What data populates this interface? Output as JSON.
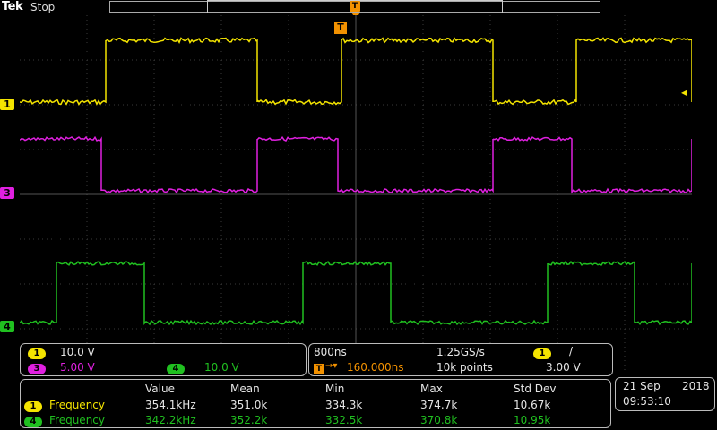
{
  "header": {
    "brand": "Tek",
    "run_state": "Stop"
  },
  "markers": {
    "trigger_glyph": "T",
    "trigger_level_glyph": "◂"
  },
  "channels": [
    {
      "id": "1",
      "color": "#f4e400"
    },
    {
      "id": "3",
      "color": "#e020e0"
    },
    {
      "id": "4",
      "color": "#20c020"
    }
  ],
  "scale_panel": {
    "ch1_id": "1",
    "ch1_scale": "10.0 V",
    "ch3_id": "3",
    "ch3_scale": "5.00 V",
    "ch4_id": "4",
    "ch4_scale": "10.0 V"
  },
  "timebase_panel": {
    "time_per_div": "800ns",
    "sample_rate": "1.25GS/s",
    "trigger_source_id": "1",
    "trigger_slope_glyph": "/",
    "trigger_pos_glyph": "T",
    "trigger_arrow_glyph": "→▾",
    "trigger_position": "160.000ns",
    "record_length": "10k points",
    "trigger_level": "3.00 V"
  },
  "measurements": {
    "headers": [
      "Value",
      "Mean",
      "Min",
      "Max",
      "Std Dev"
    ],
    "rows": [
      {
        "ch": "1",
        "name": "Frequency",
        "value": "354.1kHz",
        "mean": "351.0k",
        "min": "334.3k",
        "max": "374.7k",
        "std": "10.67k"
      },
      {
        "ch": "4",
        "name": "Frequency",
        "value": "342.2kHz",
        "mean": "352.2k",
        "min": "332.5k",
        "max": "370.8k",
        "std": "10.95k"
      }
    ]
  },
  "datetime": {
    "date": "21 Sep",
    "year": "2018",
    "time": "09:53:10"
  }
}
